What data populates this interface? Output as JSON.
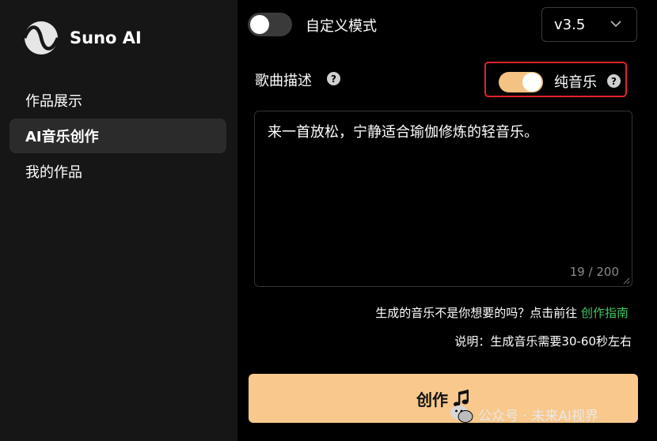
{
  "sidebar": {
    "brand": "Suno AI",
    "items": [
      {
        "label": "作品展示",
        "active": false
      },
      {
        "label": "AI音乐创作",
        "active": true
      },
      {
        "label": "我的作品",
        "active": false
      }
    ]
  },
  "main": {
    "custom_mode_label": "自定义模式",
    "custom_mode_on": false,
    "version_value": "v3.5",
    "description_label": "歌曲描述",
    "pure_music_label": "纯音乐",
    "pure_music_on": true,
    "prompt_text": "来一首放松，宁静适合瑜伽修炼的轻音乐。",
    "char_count": "19 / 200",
    "hint_text": "生成的音乐不是你想要的吗？点击前往 ",
    "hint_link": "创作指南",
    "note_text": "说明：生成音乐需要30-60秒左右",
    "create_label": "创作"
  },
  "watermark": "公众号 · 未来AI视界",
  "colors": {
    "accent": "#f8c88c",
    "toggle_on": "#f4c283",
    "link_green": "#3fc866",
    "highlight_red": "#e0242a",
    "sidebar_bg": "#161616"
  }
}
